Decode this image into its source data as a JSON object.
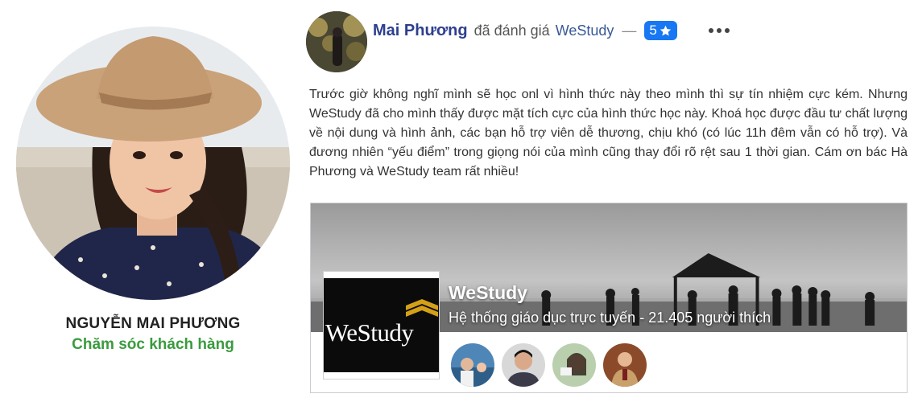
{
  "profile": {
    "name": "NGUYỄN MAI PHƯƠNG",
    "role": "Chăm sóc khách hàng"
  },
  "review": {
    "reviewer_name": "Mai Phương",
    "verb": "đã đánh giá",
    "page_name": "WeStudy",
    "dash": "—",
    "rating": "5",
    "rating_icon": "star-icon",
    "text": "Trước giờ không nghĩ mình sẽ học onl vì hình thức này theo mình thì sự tín nhiệm cực kém. Nhưng WeStudy đã cho mình thấy được mặt tích cực của hình thức học này. Khoá học được đầu tư chất lượng về nội dung và hình ảnh, các bạn hỗ trợ viên dễ thương, chịu khó (có lúc 11h đêm vẫn có hỗ trợ). Và đương nhiên “yếu điểm” trong giọng nói của mình cũng thay đổi rõ rệt sau 1 thời gian. Cám ơn bác Hà Phương và WeStudy team rất nhiều!"
  },
  "page_card": {
    "logo_text": "WeStudy",
    "title": "WeStudy",
    "subtitle": "Hệ thống giáo dục trực tuyến - 21.405 người thích",
    "friend_count": 4
  },
  "colors": {
    "accent_green": "#3a9b3f",
    "reviewer_blue": "#2d3f8f",
    "badge_blue": "#1877f2",
    "link_blue": "#385898"
  }
}
